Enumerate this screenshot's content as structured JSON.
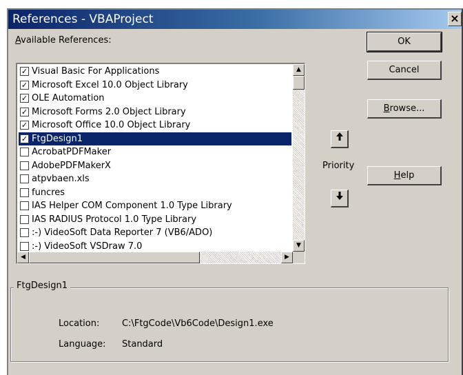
{
  "window": {
    "title": "References - VBAProject",
    "close_glyph": "×"
  },
  "available_label_prefix": "A",
  "available_label_rest": "vailable References:",
  "references": [
    {
      "label": "Visual Basic For Applications",
      "checked": true
    },
    {
      "label": "Microsoft Excel 10.0 Object Library",
      "checked": true
    },
    {
      "label": "OLE Automation",
      "checked": true
    },
    {
      "label": "Microsoft Forms 2.0 Object Library",
      "checked": true
    },
    {
      "label": "Microsoft Office 10.0 Object Library",
      "checked": true
    },
    {
      "label": "FtgDesign1",
      "checked": true,
      "selected": true
    },
    {
      "label": "AcrobatPDFMaker",
      "checked": false
    },
    {
      "label": "AdobePDFMakerX",
      "checked": false
    },
    {
      "label": "atpvbaen.xls",
      "checked": false
    },
    {
      "label": "funcres",
      "checked": false
    },
    {
      "label": " IAS Helper COM Component 1.0 Type Library",
      "checked": false
    },
    {
      "label": " IAS RADIUS Protocol 1.0 Type Library",
      "checked": false
    },
    {
      "label": ":-) VideoSoft Data Reporter 7 (VB6/ADO)",
      "checked": false
    },
    {
      "label": ":-) VideoSoft VSDraw 7.0",
      "checked": false
    }
  ],
  "buttons": {
    "ok": "OK",
    "cancel": "Cancel",
    "browse_prefix": "B",
    "browse_rest": "rowse...",
    "help_prefix": "H",
    "help_rest": "elp"
  },
  "priority": {
    "label": "Priority",
    "up_glyph": "🠕",
    "down_glyph": "🠗"
  },
  "details": {
    "group_title": "FtgDesign1",
    "location_label": "Location:",
    "location_value": "C:\\FtgCode\\Vb6Code\\Design1.exe",
    "language_label": "Language:",
    "language_value": "Standard"
  },
  "colors": {
    "dialog_bg": "#d4d0c8",
    "title_start": "#0a246a",
    "title_end": "#a6caf0",
    "selection": "#0a246a"
  }
}
